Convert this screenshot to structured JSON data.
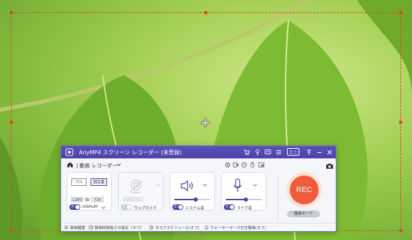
{
  "colors": {
    "accent": "#4b43a8",
    "rec": "#ef5b3b",
    "selection": "#e0412a"
  },
  "app": {
    "title": "AnyMP4 スクリーン レコーダー (未登録)",
    "mini_label": "ミニ",
    "mode_label": "| 動画 レコーダー"
  },
  "display": {
    "full_label": "フル",
    "custom_label": "固定基",
    "width": "1280",
    "height": "720",
    "toggle": "オン",
    "label": "DISPLAY"
  },
  "webcam": {
    "toggle": "オフ",
    "label": "ウェブカメラ"
  },
  "system_sound": {
    "toggle": "オン",
    "label": "システム音",
    "level": 0.6
  },
  "mic": {
    "toggle": "オン",
    "label": "マイク音",
    "level": 0.55
  },
  "rec": {
    "label": "REC",
    "mode_label": "録画モード"
  },
  "footer": {
    "history": "録画履歴",
    "duration": "録画時間長さの設定（オフ）",
    "schedule": "タスクスケジュール(オフ)",
    "watermark": "ウォーターマーク付き録画(オフ)"
  }
}
